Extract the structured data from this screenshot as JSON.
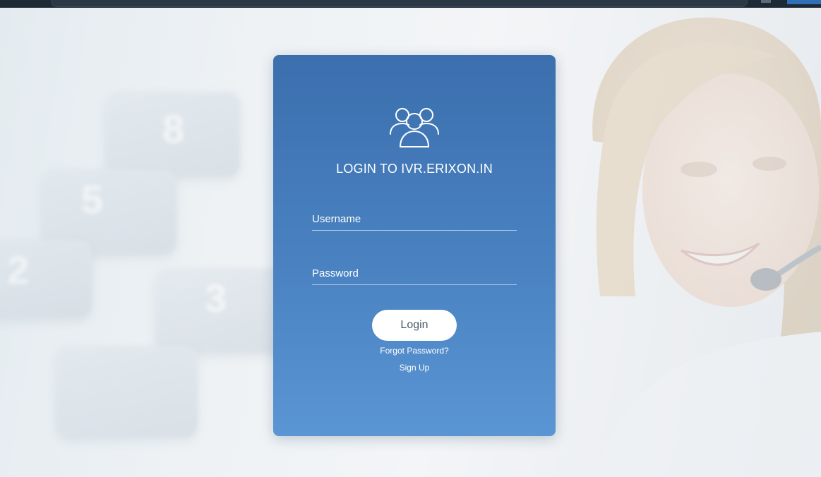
{
  "login": {
    "title": "LOGIN TO IVR.ERIXON.IN",
    "username_placeholder": "Username",
    "password_placeholder": "Password",
    "login_label": "Login",
    "forgot_label": "Forgot Password?",
    "signup_label": "Sign Up",
    "icon": "users-icon"
  },
  "background": {
    "keypad_digits": [
      "8",
      "5",
      "2",
      "3"
    ]
  },
  "colors": {
    "card_top": "#3b6fae",
    "card_bottom": "#5a95d4",
    "button_bg": "#ffffff",
    "text": "#ffffff"
  }
}
